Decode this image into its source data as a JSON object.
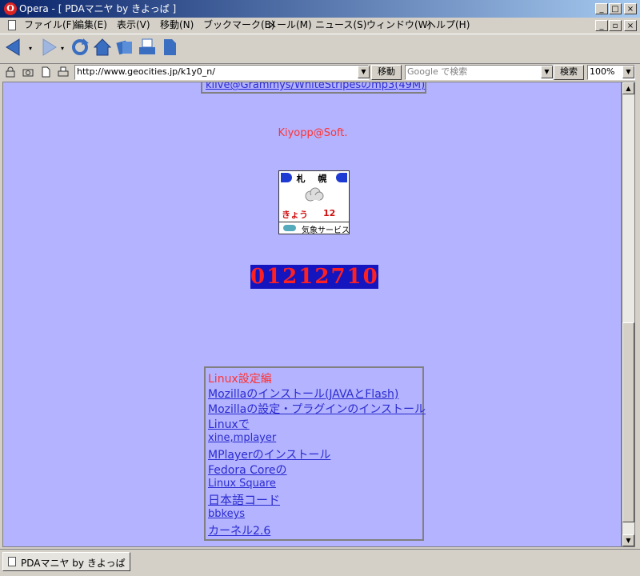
{
  "window": {
    "title": "Opera - [ PDAマニヤ by きよっぱ ]",
    "controls": [
      "_",
      "□",
      "×"
    ],
    "inner_controls": [
      "_",
      "▫",
      "×"
    ]
  },
  "menu": [
    "ファイル(F)",
    "編集(E)",
    "表示(V)",
    "移動(N)",
    "ブックマーク(B)",
    "メール(M)",
    "ニュース(S)",
    "ウィンドウ(W)",
    "ヘルプ(H)"
  ],
  "toolbar": {
    "icons": [
      "back-icon",
      "forward-icon",
      "reload-icon",
      "home-icon",
      "bookmarks-icon",
      "print-icon",
      "page-icon"
    ]
  },
  "address": {
    "url": "http://www.geocities.jp/k1y0_n/",
    "go_label": "移動",
    "search_placeholder": "Google で検索",
    "search_label": "検索",
    "zoom": "100%"
  },
  "page": {
    "top_link": "klive@Grammys/WhiteStripesのmp3(49M)",
    "author": "Kiyopp@Soft.",
    "weather": {
      "city": "札 幌",
      "day": "きょう",
      "temp": "12",
      "service": "気象サービス"
    },
    "counter": "01212710",
    "links_heading": "Linux設定編",
    "links": [
      "Mozillaのインストール(JAVAとFlash)",
      "Mozillaの設定・プラグインのインストール",
      "Linuxで",
      "xine,mplayer",
      "MPlayerのインストール",
      "Fedora Coreの",
      "Linux Square",
      "日本語コード",
      "bbkeys",
      "カーネル2.6"
    ]
  },
  "status": {
    "tab_label": "PDAマニヤ by きよっぱ"
  },
  "colors": {
    "page_bg": "#b3b3ff",
    "link": "#2b2bd0",
    "accent_red": "#ff3333",
    "titlebar_start": "#0a246a",
    "titlebar_end": "#a6caf0"
  }
}
